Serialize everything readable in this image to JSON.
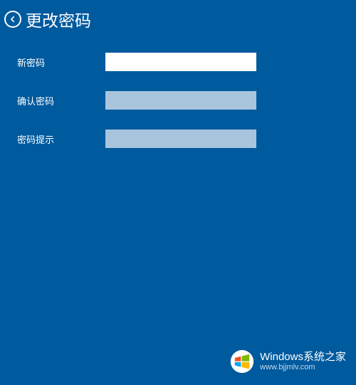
{
  "header": {
    "title": "更改密码"
  },
  "form": {
    "new_password": {
      "label": "新密码",
      "value": ""
    },
    "confirm_password": {
      "label": "确认密码",
      "value": ""
    },
    "password_hint": {
      "label": "密码提示",
      "value": ""
    }
  },
  "watermark": {
    "brand_en": "Windows",
    "brand_cn": "系统之家",
    "url": "www.bjjmlv.com"
  }
}
